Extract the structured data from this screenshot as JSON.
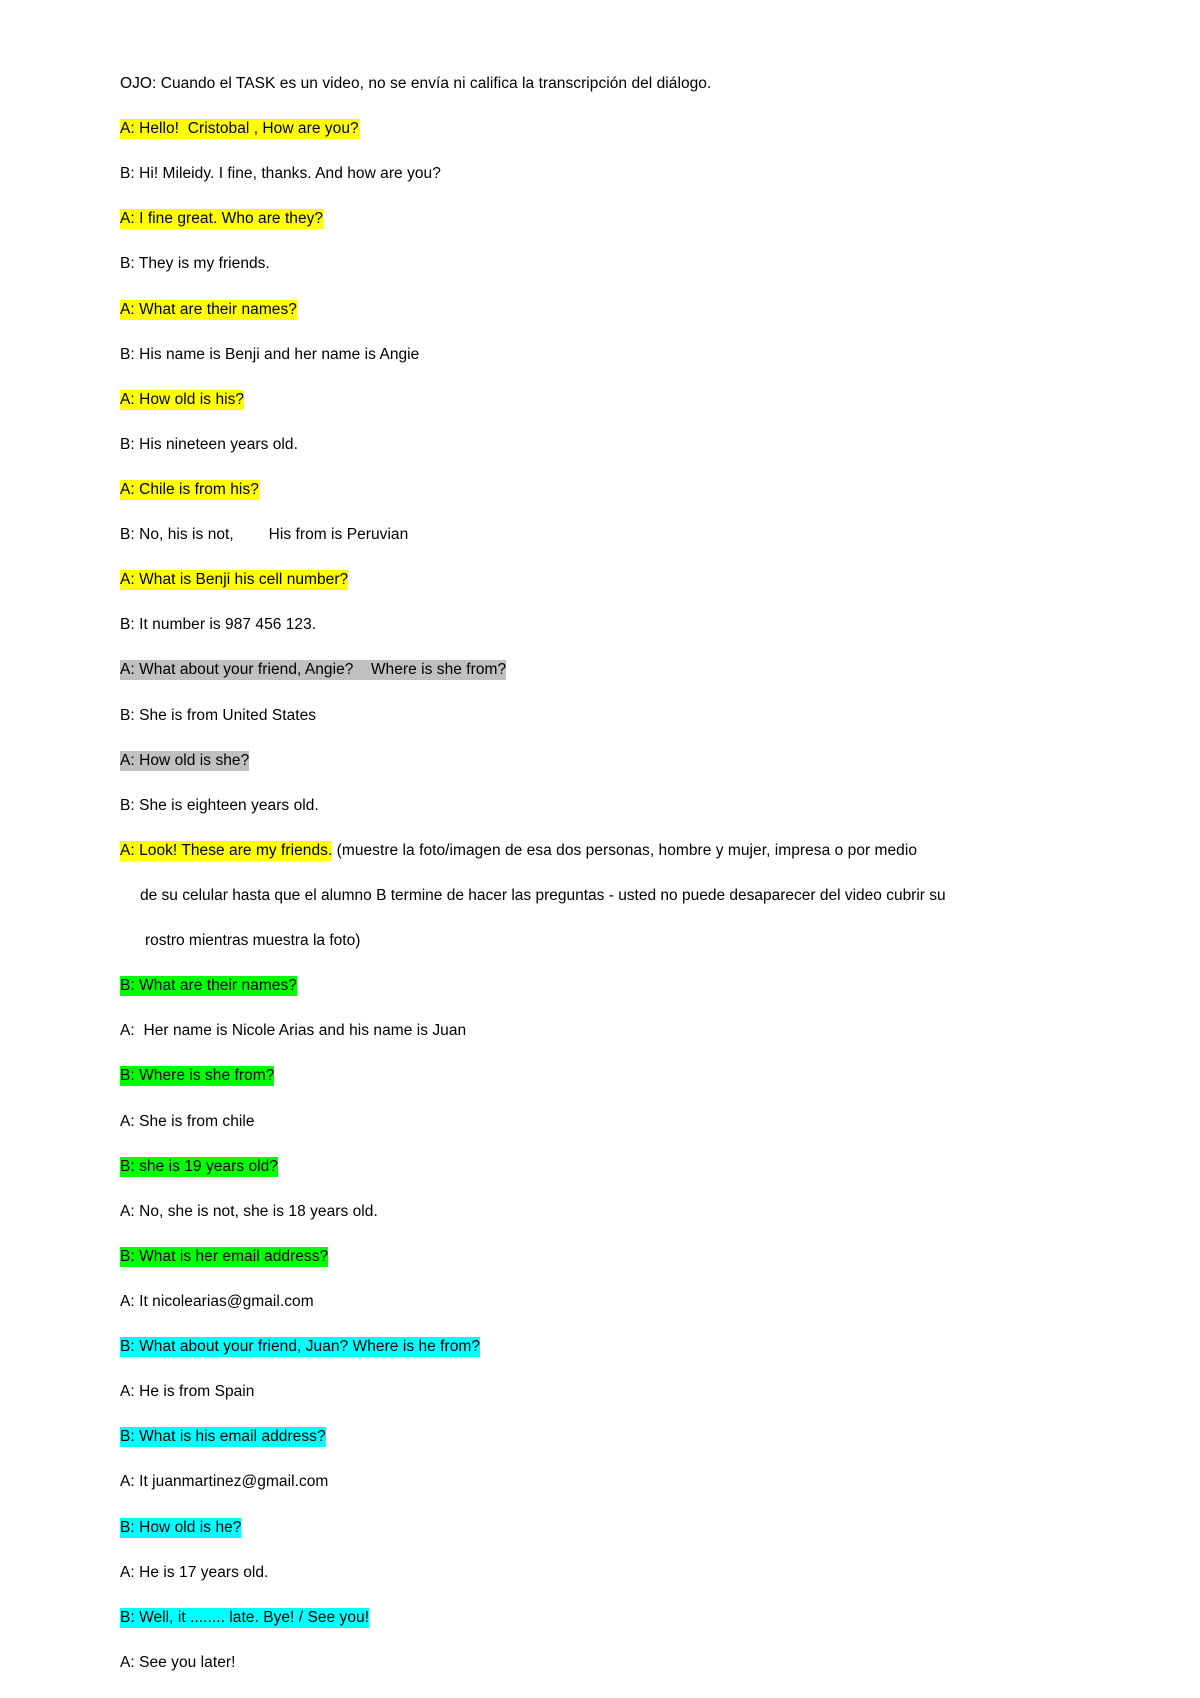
{
  "document": {
    "background_color": "#ffffff",
    "text_color": "#000000",
    "highlight_colors": {
      "yellow": "#FFFF00",
      "gray": "#C0C0C0",
      "green": "#00FF00",
      "cyan": "#00FFFF"
    },
    "intro_note": "OJO: Cuando el TASK es un video, no se envía ni califica la transcripción del diálogo.",
    "lines": [
      {
        "text": "A: Hello!  Cristobal , How are you?",
        "highlight": "yellow"
      },
      {
        "text": "B: Hi! Mileidy. I fine, thanks. And how are you?",
        "highlight": "none"
      },
      {
        "text": "A: I fine great. Who are they?",
        "highlight": "yellow"
      },
      {
        "text": "B: They is my friends.",
        "highlight": "none"
      },
      {
        "text": "A: What are their names?",
        "highlight": "yellow"
      },
      {
        "text": "B: His name is Benji and her name is Angie",
        "highlight": "none"
      },
      {
        "text": "A: How old is his?",
        "highlight": "yellow"
      },
      {
        "text": "B: His nineteen years old.",
        "highlight": "none"
      },
      {
        "text": "A: Chile is from his?",
        "highlight": "yellow"
      },
      {
        "text": "B: No, his is not,        His from is Peruvian",
        "highlight": "none"
      },
      {
        "text": "A: What is Benji his cell number?",
        "highlight": "yellow"
      },
      {
        "text": "B: It number is 987 456 123.",
        "highlight": "none"
      },
      {
        "text": "A: What about your friend, Angie?    Where is she from?",
        "highlight": "gray"
      },
      {
        "text": "B: She is from United States",
        "highlight": "none"
      },
      {
        "text": "A: How old is she?",
        "highlight": "gray"
      },
      {
        "text": "B: She is eighteen years old.",
        "highlight": "none"
      }
    ],
    "stage_direction": {
      "highlighted_part": "A: Look! These are my friends.",
      "highlight": "yellow",
      "plain_part": " (muestre la foto/imagen de esa dos personas, hombre y mujer, impresa o por medio",
      "continuation_line_1": "de su celular hasta que el alumno B termine de hacer las preguntas - usted no puede desaparecer del video cubrir su",
      "continuation_line_2": "rostro mientras muestra la foto)"
    },
    "lines_after": [
      {
        "text": "B: What are their names?",
        "highlight": "green"
      },
      {
        "text": "A:  Her name is Nicole Arias and his name is Juan",
        "highlight": "none"
      },
      {
        "text": "B: Where is she from?",
        "highlight": "green"
      },
      {
        "text": "A: She is from chile",
        "highlight": "none"
      },
      {
        "text": "B: she is 19 years old?",
        "highlight": "green"
      },
      {
        "text": "A: No, she is not, she is 18 years old.",
        "highlight": "none"
      },
      {
        "text": "B: What is her email address?",
        "highlight": "green"
      },
      {
        "text": "A: It nicolearias@gmail.com",
        "highlight": "none"
      },
      {
        "text": "B: What about your friend, Juan? Where is he from?",
        "highlight": "cyan"
      },
      {
        "text": "A: He is from Spain",
        "highlight": "none"
      },
      {
        "text": "B: What is his email address?",
        "highlight": "cyan"
      },
      {
        "text": "A: It juanmartinez@gmail.com",
        "highlight": "none"
      },
      {
        "text": "B: How old is he?",
        "highlight": "cyan"
      },
      {
        "text": "A: He is 17 years old.",
        "highlight": "none"
      },
      {
        "text": "B: Well, it ........ late. Bye! / See you!",
        "highlight": "cyan"
      },
      {
        "text": "A: See you later!",
        "highlight": "none"
      }
    ]
  }
}
